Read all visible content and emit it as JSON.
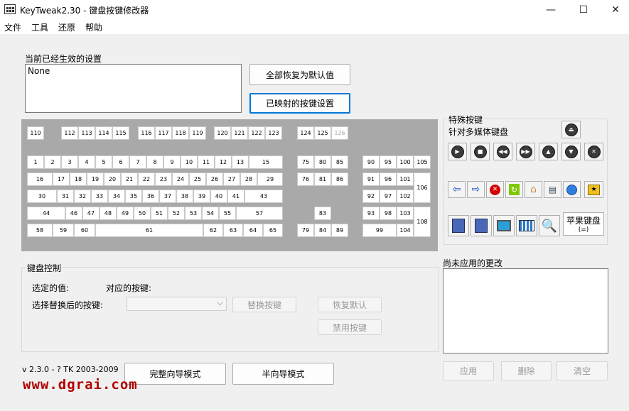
{
  "window": {
    "title": "KeyTweak2.30 -  键盘按键修改器",
    "minimize": "—",
    "maximize": "☐",
    "close": "✕"
  },
  "menu": [
    "文件",
    "工具",
    "还原",
    "帮助"
  ],
  "current_settings": {
    "label": "当前已经生效的设置",
    "value": "None"
  },
  "buttons": {
    "restore_all": "全部恢复为默认值",
    "mapped_settings": "已映射的按键设置",
    "replace_key": "替换按键",
    "restore_default": "恢复默认",
    "disable_key": "禁用按键",
    "full_wizard": "完整向导模式",
    "half_wizard": "半向导模式",
    "apply": "应用",
    "delete": "删除",
    "clear": "清空"
  },
  "keyboard": {
    "keys": {
      "fn": [
        "110",
        "112",
        "113",
        "114",
        "115",
        "116",
        "117",
        "118",
        "119",
        "120",
        "121",
        "122",
        "123",
        "124",
        "125",
        "126"
      ],
      "r1": [
        "1",
        "2",
        "3",
        "4",
        "5",
        "6",
        "7",
        "8",
        "9",
        "10",
        "11",
        "12",
        "13",
        "15"
      ],
      "r2": [
        "16",
        "17",
        "18",
        "19",
        "20",
        "21",
        "22",
        "23",
        "24",
        "25",
        "26",
        "27",
        "28",
        "29"
      ],
      "r3": [
        "30",
        "31",
        "32",
        "33",
        "34",
        "35",
        "36",
        "37",
        "38",
        "39",
        "40",
        "41",
        "43"
      ],
      "r4": [
        "44",
        "46",
        "47",
        "48",
        "49",
        "50",
        "51",
        "52",
        "53",
        "54",
        "55",
        "57"
      ],
      "r5": [
        "58",
        "59",
        "60",
        "61",
        "62",
        "63",
        "64",
        "65"
      ],
      "nav": [
        "75",
        "80",
        "85",
        "76",
        "81",
        "86",
        "83",
        "79",
        "84",
        "89"
      ],
      "num": [
        "90",
        "95",
        "100",
        "105",
        "91",
        "96",
        "101",
        "106",
        "92",
        "97",
        "102",
        "93",
        "98",
        "103",
        "108",
        "99",
        "104"
      ]
    }
  },
  "special_keys": {
    "title": "特殊按键",
    "subtitle": "针对多媒体键盘",
    "apple_label": "苹果键盘",
    "apple_sub": "(=)"
  },
  "keyboard_control": {
    "title": "键盘控制",
    "selected_value": "选定的值:",
    "mapped_key": "对应的按键:",
    "choose_replacement": "选择替换后的按键:"
  },
  "pending": {
    "title": "尚未应用的更改"
  },
  "version": "v 2.3.0 - ? TK 2003-2009",
  "watermark": "www.dgrai.com"
}
